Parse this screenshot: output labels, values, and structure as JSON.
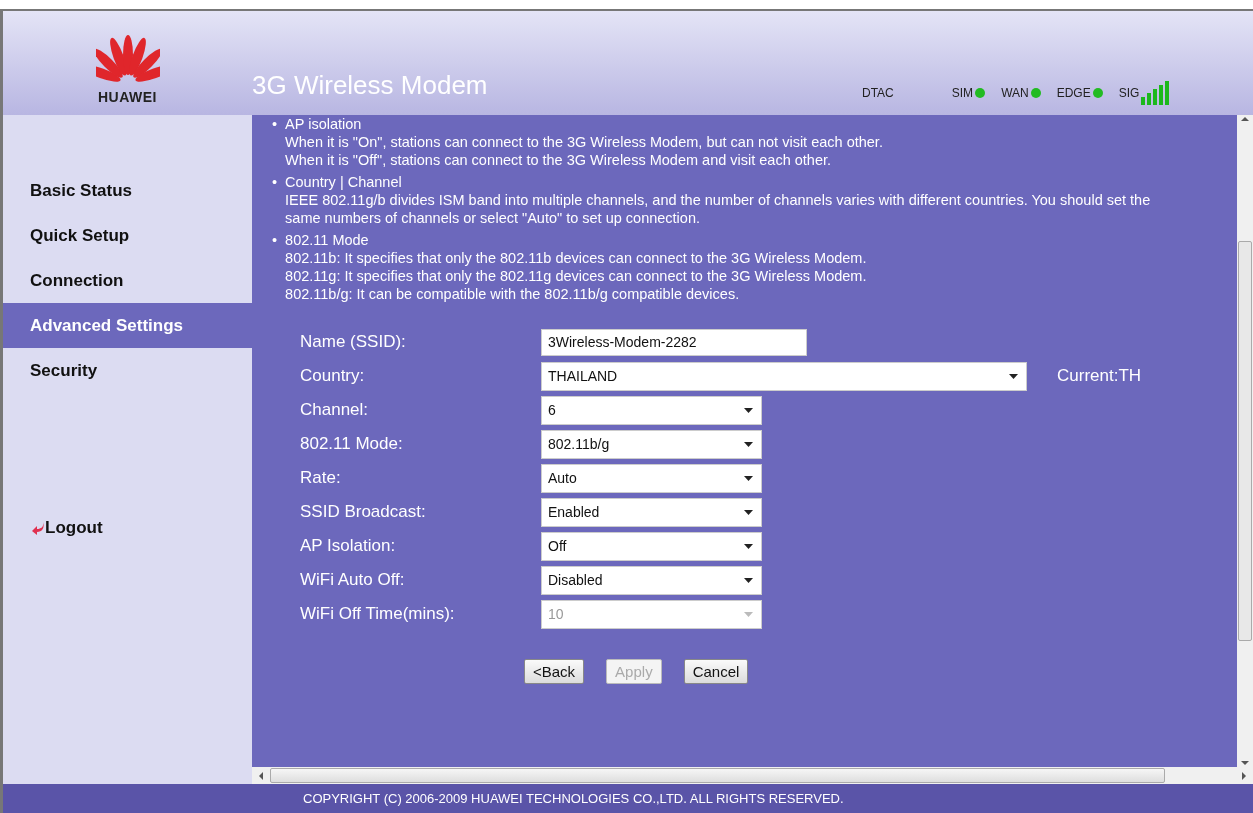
{
  "header": {
    "logo_text": "HUAWEI",
    "title": "3G Wireless Modem",
    "operator": "DTAC",
    "indicators": [
      {
        "label": "SIM",
        "on": true
      },
      {
        "label": "WAN",
        "on": true
      },
      {
        "label": "EDGE",
        "on": true
      }
    ],
    "signal_label": "SIG"
  },
  "sidebar": {
    "items": [
      {
        "label": "Basic Status",
        "selected": false
      },
      {
        "label": "Quick Setup",
        "selected": false
      },
      {
        "label": "Connection",
        "selected": false
      },
      {
        "label": "Advanced Settings",
        "selected": true
      },
      {
        "label": "Security",
        "selected": false
      }
    ],
    "logout": "Logout"
  },
  "help": [
    {
      "bullet": "•",
      "title": "AP isolation",
      "lines": [
        "When it is \"On\", stations can connect to the 3G Wireless Modem, but can not visit each other.",
        "When it is \"Off\", stations can connect to the 3G Wireless Modem and visit each other."
      ]
    },
    {
      "bullet": "•",
      "title": "Country | Channel",
      "lines": [
        "IEEE 802.11g/b divides ISM band into multiple channels, and the number of channels varies with different countries. You should set the same numbers of channels or select \"Auto\" to set up connection."
      ]
    },
    {
      "bullet": "•",
      "title": "802.11 Mode",
      "lines": [
        "802.11b: It specifies that only the 802.11b devices can connect to the 3G Wireless Modem.",
        "802.11g: It specifies that only the 802.11g devices can connect to the 3G Wireless Modem.",
        "802.11b/g: It can be compatible with the 802.11b/g compatible devices."
      ]
    }
  ],
  "form": [
    {
      "kind": "text",
      "label": "Name (SSID):",
      "value": "3Wireless-Modem-2282",
      "disabled": false
    },
    {
      "kind": "wide-select",
      "label": "Country:",
      "value": "THAILAND",
      "note": "Current:TH",
      "disabled": false
    },
    {
      "kind": "select",
      "label": "Channel:",
      "value": "6",
      "disabled": false
    },
    {
      "kind": "select",
      "label": "802.11 Mode:",
      "value": "802.11b/g",
      "disabled": false
    },
    {
      "kind": "select",
      "label": "Rate:",
      "value": "Auto",
      "disabled": false
    },
    {
      "kind": "select",
      "label": "SSID Broadcast:",
      "value": "Enabled",
      "disabled": false
    },
    {
      "kind": "select",
      "label": "AP Isolation:",
      "value": "Off",
      "disabled": false
    },
    {
      "kind": "select",
      "label": "WiFi Auto Off:",
      "value": "Disabled",
      "disabled": false
    },
    {
      "kind": "select",
      "label": "WiFi Off Time(mins):",
      "value": "10",
      "disabled": true
    }
  ],
  "buttons": [
    {
      "label": "<Back",
      "disabled": false
    },
    {
      "label": "Apply",
      "disabled": true
    },
    {
      "label": "Cancel",
      "disabled": false
    }
  ],
  "footer": "COPYRIGHT (C) 2006-2009 HUAWEI TECHNOLOGIES CO.,LTD. ALL RIGHTS RESERVED."
}
